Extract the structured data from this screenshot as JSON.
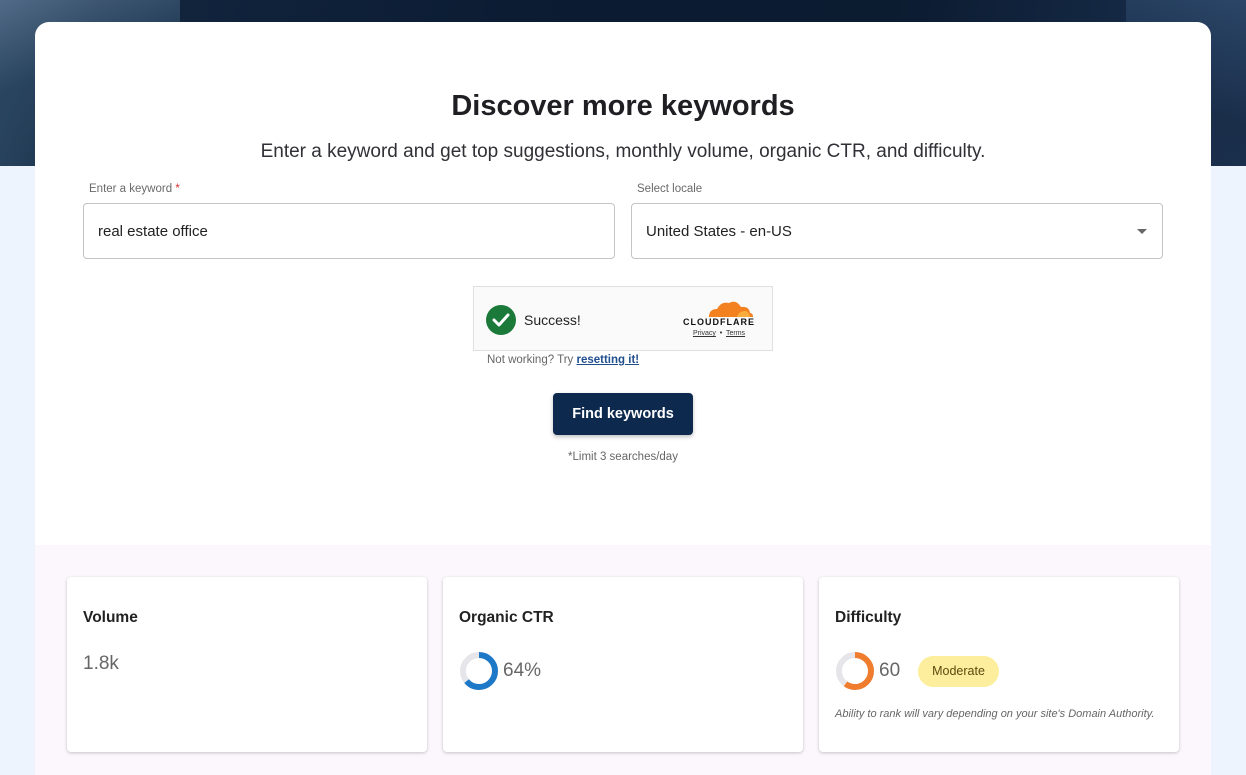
{
  "header": {
    "title": "Discover more keywords",
    "subtitle": "Enter a keyword and get top suggestions, monthly volume, organic CTR, and difficulty."
  },
  "form": {
    "keyword_label": "Enter a keyword",
    "required_mark": "*",
    "keyword_value": "real estate office",
    "locale_label": "Select locale",
    "locale_value": "United States - en-US",
    "captcha_status": "Success!",
    "captcha_brand": "CLOUDFLARE",
    "captcha_privacy": "Privacy",
    "captcha_separator": "•",
    "captcha_terms": "Terms",
    "not_working_text": "Not working? Try",
    "reset_link": "resetting it!",
    "submit_label": "Find keywords",
    "limit_note": "*Limit 3 searches/day"
  },
  "metrics": {
    "volume": {
      "title": "Volume",
      "value": "1.8k"
    },
    "ctr": {
      "title": "Organic CTR",
      "value": "64%",
      "fraction": 0.64,
      "color": "#1e78c8"
    },
    "difficulty": {
      "title": "Difficulty",
      "value": "60",
      "fraction": 0.6,
      "color": "#f07d2e",
      "badge": "Moderate",
      "note": "Ability to rank will vary depending on your site's Domain Authority."
    }
  },
  "colors": {
    "primary_button": "#0d2a4e",
    "success": "#1b7a3a",
    "badge_bg": "#fcee9c",
    "cloudflare_orange": "#f48120"
  },
  "icons": {
    "captcha": "check-circle-icon",
    "select": "caret-down-icon",
    "brand": "cloudflare-cloud-icon"
  }
}
